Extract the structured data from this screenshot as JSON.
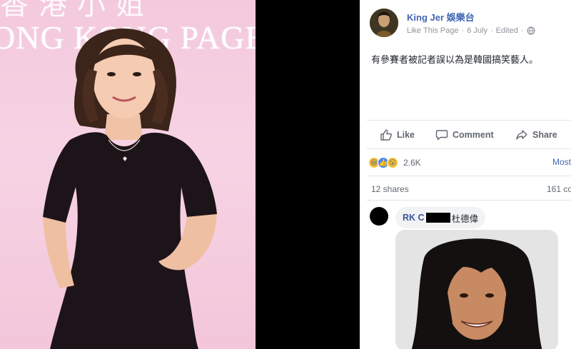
{
  "left_photo": {
    "backdrop_top": "香港小姐",
    "backdrop_text": "ONG KONG PAGE"
  },
  "post": {
    "page_name": "King Jer 娛樂台",
    "like_page": "Like This Page",
    "date": "6 July",
    "edited": "Edited",
    "body": "有參賽者被記者誤以為是韓國搞笑藝人。",
    "actions": {
      "like": "Like",
      "comment": "Comment",
      "share": "Share"
    },
    "reactions": {
      "count": "2.6K",
      "most_relevant": "Most re"
    },
    "shares": "12 shares",
    "comments": "161 co",
    "comment": {
      "author": "RK C",
      "text": "杜德偉"
    }
  },
  "colors": {
    "fb_blue": "#4267b2",
    "meta_grey": "#90949c",
    "backdrop_pink": "#f4c9dd"
  }
}
